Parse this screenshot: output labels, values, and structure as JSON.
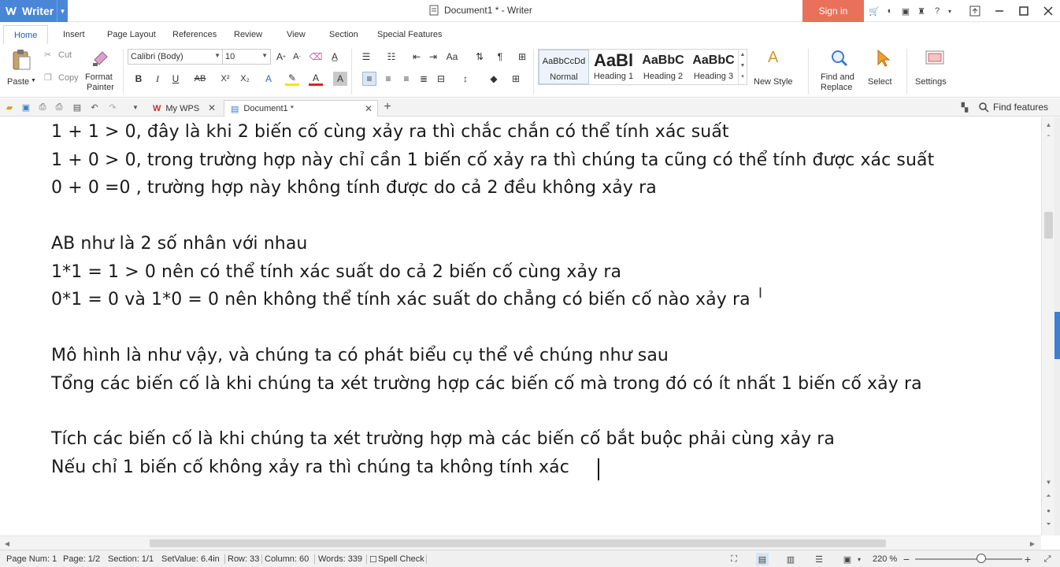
{
  "titlebar": {
    "app_name": "Writer",
    "doc_title": "Document1 * - Writer",
    "signin": "Sign in"
  },
  "menu": {
    "tabs": [
      "Home",
      "Insert",
      "Page Layout",
      "References",
      "Review",
      "View",
      "Section",
      "Special Features"
    ]
  },
  "ribbon": {
    "paste": "Paste",
    "cut": "Cut",
    "copy": "Copy",
    "format_painter_1": "Format",
    "format_painter_2": "Painter",
    "font_name": "Calibri (Body)",
    "font_size": "10",
    "styles": [
      {
        "preview": "AaBbCcDd",
        "label": "Normal"
      },
      {
        "preview": "AaBl",
        "label": "Heading 1"
      },
      {
        "preview": "AaBbC",
        "label": "Heading 2"
      },
      {
        "preview": "AaBbC",
        "label": "Heading 3"
      }
    ],
    "new_style": "New Style",
    "find_replace_1": "Find and",
    "find_replace_2": "Replace",
    "select": "Select",
    "settings": "Settings"
  },
  "docbar": {
    "tabs": [
      {
        "label": "My WPS"
      },
      {
        "label": "Document1 *"
      }
    ],
    "find_features": "Find features"
  },
  "document": {
    "lines": [
      "1 + 1 > 0, đây là khi 2 biến cố cùng xảy ra thì chắc chắn có thể tính xác suất",
      "1 + 0 > 0, trong trường hợp này chỉ cần 1 biến cố xảy ra thì chúng ta cũng có thể tính được xác suất",
      "0 + 0 =0 , trường hợp này không tính được do cả 2 đều không xảy ra",
      "AB như là 2 số nhân với nhau",
      "1*1 = 1 > 0 nên có thể tính xác suất do cả 2 biến cố cùng xảy ra",
      "0*1 = 0 và 1*0 = 0 nên không thể tính xác suất do chẳng có biến cố nào xảy ra",
      "Mô hình là như vậy, và chúng ta có phát biểu cụ thể về chúng như sau",
      "Tổng các biến cố là khi chúng ta xét trường hợp các biến cố mà trong đó có ít nhất 1 biến cố xảy ra",
      "Tích các biến cố là khi chúng ta xét trường hợp mà các biến cố bắt buộc phải cùng xảy ra",
      "Nếu chỉ 1 biến cố không xảy ra thì chúng ta không tính xác "
    ]
  },
  "status": {
    "page_num": "Page Num: 1",
    "page": "Page: 1/2",
    "section": "Section: 1/1",
    "setvalue": "SetValue: 6.4in",
    "row": "Row: 33",
    "column": "Column: 60",
    "words": "Words: 339",
    "spell_check": "Spell Check",
    "zoom": "220 %"
  },
  "colors": {
    "app_blue": "#4a86d8",
    "signin_red": "#e9715c",
    "accent_blue": "#3d7fd1"
  }
}
